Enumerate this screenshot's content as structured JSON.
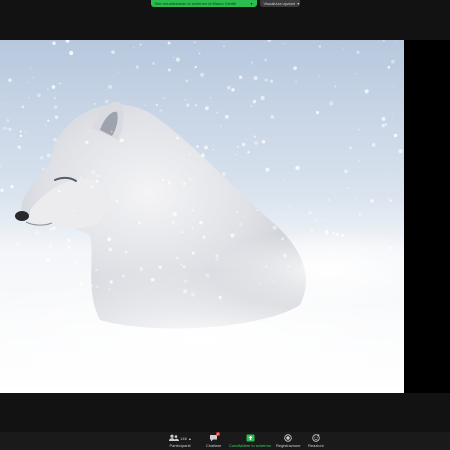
{
  "banner": {
    "share_text": "Stai visualizzando lo schermo di Marco Gentili",
    "view_options": "Visualizza opzioni"
  },
  "toolbar": {
    "participants": {
      "label": "Partecipanti",
      "count": "146"
    },
    "chat": {
      "label": "Chattare",
      "badge": "2"
    },
    "share": {
      "label": "Condividere lo schermo"
    },
    "record": {
      "label": "Registrazione"
    },
    "reactions": {
      "label": "Reazioni"
    }
  },
  "shared_content": {
    "subject": "arctic fox in snowstorm",
    "colors": {
      "accent": "#2bbd4e",
      "share_label": "#45d06a",
      "badge": "#e23a3a"
    }
  }
}
